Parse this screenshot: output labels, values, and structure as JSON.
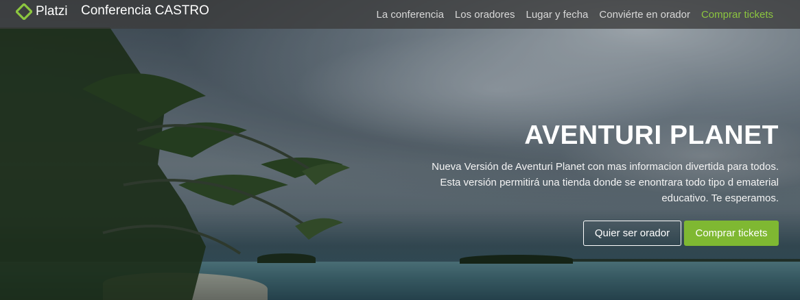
{
  "brand": {
    "logo_icon": "platzi-logo-icon",
    "name": "Platzi",
    "title": "Conferencia CASTRO",
    "accent_color": "#8cc63f"
  },
  "nav": {
    "links": [
      {
        "label": "La conferencia"
      },
      {
        "label": "Los oradores"
      },
      {
        "label": "Lugar y fecha"
      },
      {
        "label": "Conviérte en orador"
      },
      {
        "label": "Comprar tickets"
      }
    ]
  },
  "hero": {
    "title": "AVENTURI PLANET",
    "description_lines": [
      "Nueva Versión de Aventuri Planet con mas informacion divertida para todos.",
      "Esta versión permitirá una tienda donde se enontrara todo tipo d ematerial",
      "educativo. Te esperamos."
    ],
    "buttons": {
      "speaker_label": "Quier ser orador",
      "tickets_label": "Comprar tickets"
    }
  }
}
